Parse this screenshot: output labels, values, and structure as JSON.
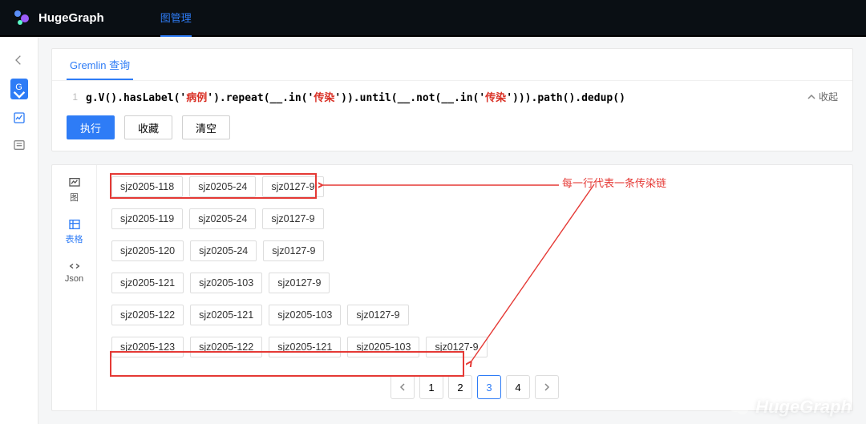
{
  "brand": {
    "name": "HugeGraph"
  },
  "top_tabs": [
    {
      "label": "图管理"
    }
  ],
  "query": {
    "tab_label": "Gremlin 查询",
    "line_number": "1",
    "code_parts": {
      "p1": "g.V().hasLabel('",
      "p2": "病例",
      "p3": "').repeat(__.in('",
      "p4": "传染",
      "p5": "')).until(__.not(__.in('",
      "p6": "传染",
      "p7": "'))).path().dedup()"
    },
    "collapse_label": "收起",
    "buttons": {
      "run": "执行",
      "fav": "收藏",
      "clear": "清空"
    }
  },
  "view_tabs": {
    "graph": "图",
    "table": "表格",
    "json": "Json"
  },
  "chains": [
    [
      "sjz0205-118",
      "sjz0205-24",
      "sjz0127-9"
    ],
    [
      "sjz0205-119",
      "sjz0205-24",
      "sjz0127-9"
    ],
    [
      "sjz0205-120",
      "sjz0205-24",
      "sjz0127-9"
    ],
    [
      "sjz0205-121",
      "sjz0205-103",
      "sjz0127-9"
    ],
    [
      "sjz0205-122",
      "sjz0205-121",
      "sjz0205-103",
      "sjz0127-9"
    ],
    [
      "sjz0205-123",
      "sjz0205-122",
      "sjz0205-121",
      "sjz0205-103",
      "sjz0127-9"
    ]
  ],
  "annotation": "每一行代表一条传染链",
  "pagination": {
    "pages": [
      "1",
      "2",
      "3",
      "4"
    ],
    "active": "3"
  },
  "watermark": "HugeGraph"
}
